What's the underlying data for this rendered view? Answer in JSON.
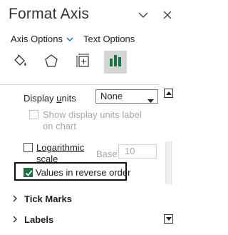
{
  "header": {
    "title": "Format Axis",
    "dropdown_icon": "chevron-down-icon",
    "close_icon": "close-icon"
  },
  "tabs": {
    "axis_options": "Axis Options",
    "text_options": "Text Options"
  },
  "icon_tabs": [
    "fill-line-icon",
    "effects-pentagon-icon",
    "size-properties-icon",
    "axis-options-bar-chart-icon"
  ],
  "options": {
    "display_units_prefix": "Display ",
    "display_units_underlined": "u",
    "display_units_suffix": "nits",
    "display_units_value": "None",
    "show_units_label": "Show display units label on chart",
    "show_units_checked": false,
    "log_scale_label_1": "Logarithmic",
    "log_scale_label_2": "scale",
    "log_scale_checked": false,
    "base_label": "Base",
    "base_value": "10",
    "reverse_order_label": "Values in reverse order",
    "reverse_order_checked": true
  },
  "sections": {
    "tick_marks": "Tick Marks",
    "labels": "Labels"
  },
  "colors": {
    "accent_green": "#1e7145",
    "text": "#222222",
    "disabled": "#a8a8a8"
  }
}
